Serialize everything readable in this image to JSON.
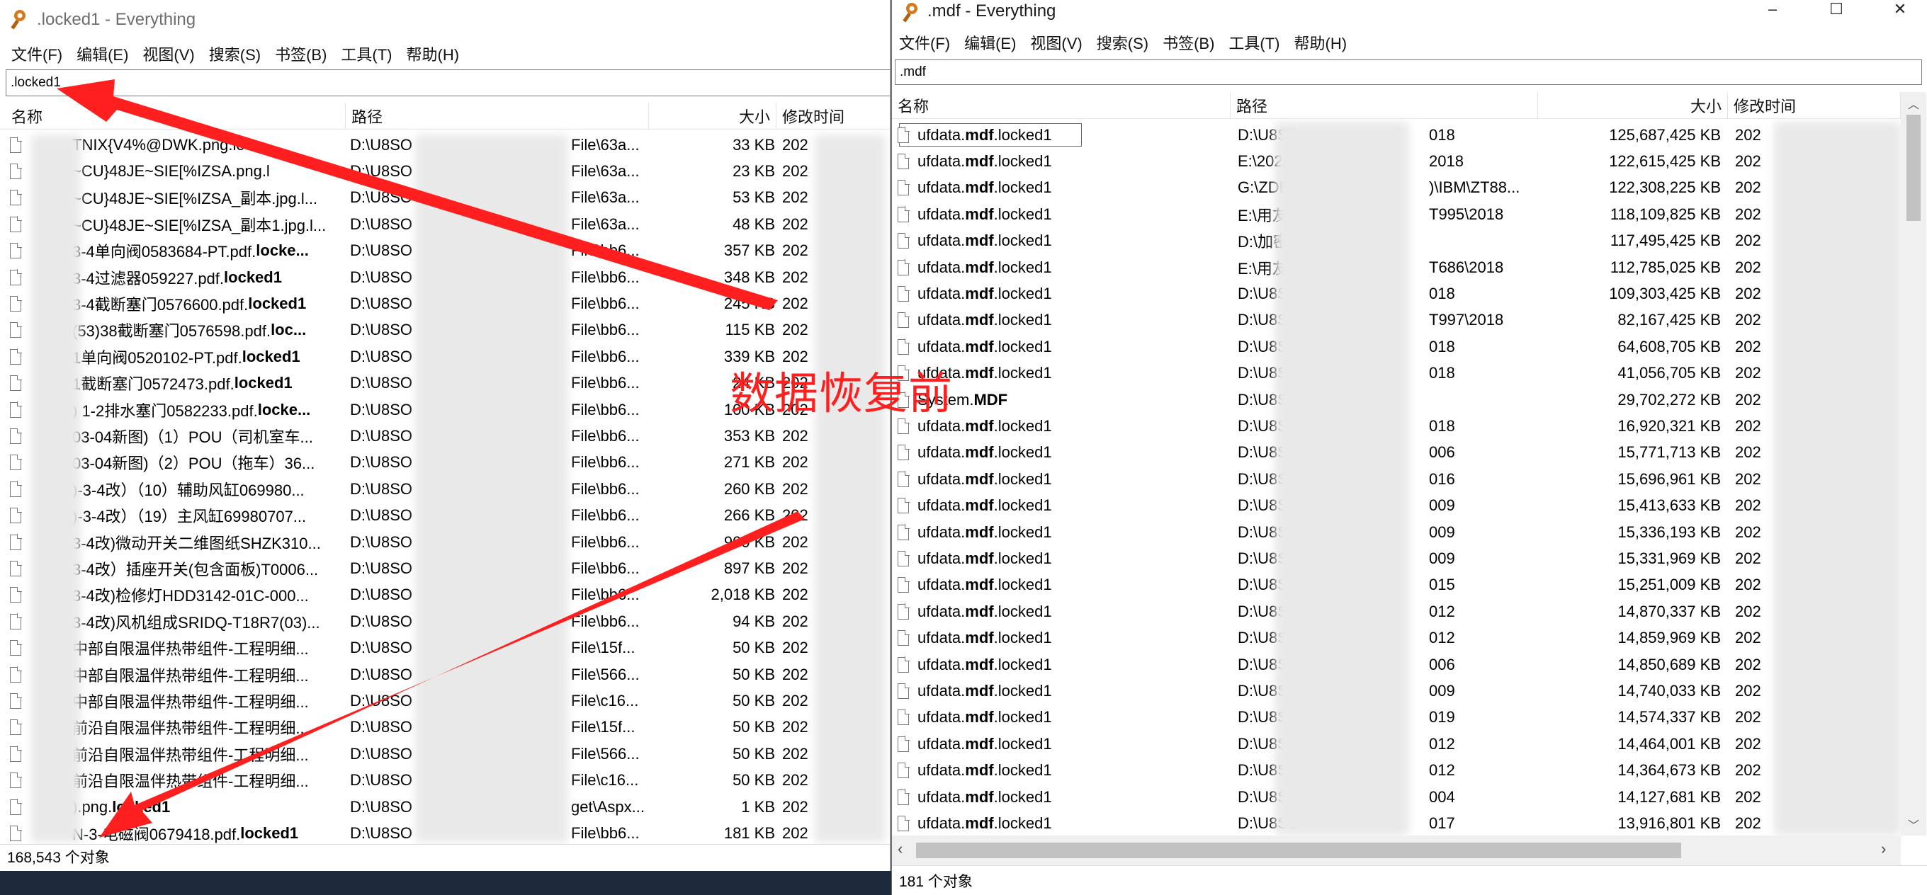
{
  "left": {
    "title": ".locked1 - Everything",
    "menu": [
      "文件(F)",
      "编辑(E)",
      "视图(V)",
      "搜索(S)",
      "书签(B)",
      "工具(T)",
      "帮助(H)"
    ],
    "search": ".locked1",
    "columns": {
      "name": "名称",
      "path": "路径",
      "size": "大小",
      "modified": "修改时间"
    },
    "rows": [
      {
        "name_pre": "TNIX{V4%@DW",
        "name_bold": "",
        "name_post": "K.png.loc...",
        "path": "D:\\U8SO",
        "path_tail": "File\\63a...",
        "size": "33 KB",
        "mod": "202"
      },
      {
        "name_pre": "~CU}48JE~SIE[%IZSA.png.l",
        "name_bold": "",
        "name_post": "",
        "path": "D:\\U8SO",
        "path_tail": "File\\63a...",
        "size": "23 KB",
        "mod": "202"
      },
      {
        "name_pre": "~CU}48JE~SIE[%IZSA_副本.jpg.l...",
        "name_bold": "",
        "name_post": "",
        "path": "D:\\U8SO",
        "path_tail": "File\\63a...",
        "size": "53 KB",
        "mod": "202"
      },
      {
        "name_pre": "~CU}48JE~SIE[%IZSA_副本1.jpg.l...",
        "name_bold": "",
        "name_post": "",
        "path": "D:\\U8SO",
        "path_tail": "File\\63a...",
        "size": "48 KB",
        "mod": "202"
      },
      {
        "name_pre": "3-4单向阀0583684-PT.pdf.",
        "name_bold": "locke...",
        "name_post": "",
        "path": "D:\\U8SO",
        "path_tail": "File\\bb6...",
        "size": "357 KB",
        "mod": "202"
      },
      {
        "name_pre": "3-4过滤器059227.pdf.",
        "name_bold": "locked1",
        "name_post": "",
        "path": "D:\\U8SO",
        "path_tail": "File\\bb6...",
        "size": "348 KB",
        "mod": "202"
      },
      {
        "name_pre": "3-4截断塞门0576600.pdf.",
        "name_bold": "locked1",
        "name_post": "",
        "path": "D:\\U8SO",
        "path_tail": "File\\bb6...",
        "size": "245 KB",
        "mod": "202"
      },
      {
        "name_pre": "(53)38截断塞门0576598.pdf.",
        "name_bold": "loc...",
        "name_post": "",
        "path": "D:\\U8SO",
        "path_tail": "File\\bb6...",
        "size": "115 KB",
        "mod": "202"
      },
      {
        "name_pre": "1单向阀0520102-PT.pdf.",
        "name_bold": "locked1",
        "name_post": "",
        "path": "D:\\U8SO",
        "path_tail": "File\\bb6...",
        "size": "339 KB",
        "mod": "202"
      },
      {
        "name_pre": "1截断塞门0572473.pdf.",
        "name_bold": "locked1",
        "name_post": "",
        "path": "D:\\U8SO",
        "path_tail": "File\\bb6...",
        "size": "24 KB",
        "mod": "202"
      },
      {
        "name_pre": ") 1-2排水塞门0582233.pdf.",
        "name_bold": "locke...",
        "name_post": "",
        "path": "D:\\U8SO",
        "path_tail": "File\\bb6...",
        "size": "100 KB",
        "mod": "202"
      },
      {
        "name_pre": "03-04新图)（1）POU（司机室车...",
        "name_bold": "",
        "name_post": "",
        "path": "D:\\U8SO",
        "path_tail": "File\\bb6...",
        "size": "353 KB",
        "mod": "202"
      },
      {
        "name_pre": "03-04新图)（2）POU（拖车）36...",
        "name_bold": "",
        "name_post": "",
        "path": "D:\\U8SO",
        "path_tail": "File\\bb6...",
        "size": "271 KB",
        "mod": "202"
      },
      {
        "name_pre": ")-3-4改）（10）辅助风缸069980...",
        "name_bold": "",
        "name_post": "",
        "path": "D:\\U8SO",
        "path_tail": "File\\bb6...",
        "size": "260 KB",
        "mod": "202"
      },
      {
        "name_pre": ")-3-4改）（19）主风缸69980707...",
        "name_bold": "",
        "name_post": "",
        "path": "D:\\U8SO",
        "path_tail": "File\\bb6...",
        "size": "266 KB",
        "mod": "202"
      },
      {
        "name_pre": "3-4改)微动开关二维图纸SHZK310...",
        "name_bold": "",
        "name_post": "",
        "path": "D:\\U8SO",
        "path_tail": "File\\bb6...",
        "size": "900 KB",
        "mod": "202"
      },
      {
        "name_pre": "3-4改）插座开关(包含面板)T0006...",
        "name_bold": "",
        "name_post": "",
        "path": "D:\\U8SO",
        "path_tail": "File\\bb6...",
        "size": "897 KB",
        "mod": "202"
      },
      {
        "name_pre": "3-4改)检修灯HDD3142-01C-000...",
        "name_bold": "",
        "name_post": "",
        "path": "D:\\U8SO",
        "path_tail": "File\\bb6...",
        "size": "2,018 KB",
        "mod": "202"
      },
      {
        "name_pre": "3-4改)风机组成SRIDQ-T18R7(03)...",
        "name_bold": "",
        "name_post": "",
        "path": "D:\\U8SO",
        "path_tail": "File\\bb6...",
        "size": "94 KB",
        "mod": "202"
      },
      {
        "name_pre": "中部自限温伴热带组件-工程明细...",
        "name_bold": "",
        "name_post": "",
        "path": "D:\\U8SO",
        "path_tail": "File\\15f...",
        "size": "50 KB",
        "mod": "202"
      },
      {
        "name_pre": "中部自限温伴热带组件-工程明细...",
        "name_bold": "",
        "name_post": "",
        "path": "D:\\U8SO",
        "path_tail": "File\\566...",
        "size": "50 KB",
        "mod": "202"
      },
      {
        "name_pre": "中部自限温伴热带组件-工程明细...",
        "name_bold": "",
        "name_post": "",
        "path": "D:\\U8SO",
        "path_tail": "File\\c16...",
        "size": "50 KB",
        "mod": "202"
      },
      {
        "name_pre": "前沿自限温伴热带组件-工程明细...",
        "name_bold": "",
        "name_post": "",
        "path": "D:\\U8SO",
        "path_tail": "File\\15f...",
        "size": "50 KB",
        "mod": "202"
      },
      {
        "name_pre": "前沿自限温伴热带组件-工程明细...",
        "name_bold": "",
        "name_post": "",
        "path": "D:\\U8SO",
        "path_tail": "File\\566...",
        "size": "50 KB",
        "mod": "202"
      },
      {
        "name_pre": "前沿自限温伴热带组件-工程明细...",
        "name_bold": "",
        "name_post": "",
        "path": "D:\\U8SO",
        "path_tail": "File\\c16...",
        "size": "50 KB",
        "mod": "202"
      },
      {
        "name_pre": ").png.",
        "name_bold": "locked1",
        "name_post": "",
        "path": "D:\\U8SO",
        "path_tail": "get\\Aspx...",
        "size": "1 KB",
        "mod": "202"
      },
      {
        "name_pre": "N-3-电磁阀0679418.pdf.",
        "name_bold": "locked1",
        "name_post": "",
        "path": "D:\\U8SO",
        "path_tail": "File\\bb6...",
        "size": "181 KB",
        "mod": "202"
      }
    ],
    "status": "168,543 个对象"
  },
  "right": {
    "title": ".mdf - Everything",
    "menu": [
      "文件(F)",
      "编辑(E)",
      "视图(V)",
      "搜索(S)",
      "书签(B)",
      "工具(T)",
      "帮助(H)"
    ],
    "search": ".mdf",
    "columns": {
      "name": "名称",
      "path": "路径",
      "size": "大小",
      "modified": "修改时间"
    },
    "rows": [
      {
        "name_pre": "ufdata.",
        "name_bold": "mdf",
        "name_post": ".locked1",
        "path": "D:\\U8SO",
        "path_tail": "018",
        "size": "125,687,425 KB",
        "mod": "202"
      },
      {
        "name_pre": "ufdata.",
        "name_bold": "mdf",
        "name_post": ".locked1",
        "path": "E:\\20220",
        "path_tail": "2018",
        "size": "122,615,425 KB",
        "mod": "202"
      },
      {
        "name_pre": "ufdata.",
        "name_bold": "mdf",
        "name_post": ".locked1",
        "path": "G:\\ZDBF",
        "path_tail": ")\\IBM\\ZT88...",
        "size": "122,308,225 KB",
        "mod": "202"
      },
      {
        "name_pre": "ufdata.",
        "name_bold": "mdf",
        "name_post": ".locked1",
        "path": "E:\\用友软",
        "path_tail": "T995\\2018",
        "size": "118,109,825 KB",
        "mod": "202"
      },
      {
        "name_pre": "ufdata.",
        "name_bold": "mdf",
        "name_post": ".locked1",
        "path": "D:\\加密\\",
        "path_tail": "",
        "size": "117,495,425 KB",
        "mod": "202"
      },
      {
        "name_pre": "ufdata.",
        "name_bold": "mdf",
        "name_post": ".locked1",
        "path": "E:\\用友软",
        "path_tail": "T686\\2018",
        "size": "112,785,025 KB",
        "mod": "202"
      },
      {
        "name_pre": "ufdata.",
        "name_bold": "mdf",
        "name_post": ".locked1",
        "path": "D:\\U8SO",
        "path_tail": "018",
        "size": "109,303,425 KB",
        "mod": "202"
      },
      {
        "name_pre": "ufdata.",
        "name_bold": "mdf",
        "name_post": ".locked1",
        "path": "D:\\U8SO",
        "path_tail": "T997\\2018",
        "size": "82,167,425 KB",
        "mod": "202"
      },
      {
        "name_pre": "ufdata.",
        "name_bold": "mdf",
        "name_post": ".locked1",
        "path": "D:\\U8SO",
        "path_tail": "018",
        "size": "64,608,705 KB",
        "mod": "202"
      },
      {
        "name_pre": "ufdata.",
        "name_bold": "mdf",
        "name_post": ".locked1",
        "path": "D:\\U8SO",
        "path_tail": "018",
        "size": "41,056,705 KB",
        "mod": "202"
      },
      {
        "name_pre": "System.",
        "name_bold": "MDF",
        "name_post": "",
        "path": "D:\\U8SO",
        "path_tail": "",
        "size": "29,702,272 KB",
        "mod": "202"
      },
      {
        "name_pre": "ufdata.",
        "name_bold": "mdf",
        "name_post": ".locked1",
        "path": "D:\\U8SO",
        "path_tail": "018",
        "size": "16,920,321 KB",
        "mod": "202"
      },
      {
        "name_pre": "ufdata.",
        "name_bold": "mdf",
        "name_post": ".locked1",
        "path": "D:\\U8SO",
        "path_tail": "006",
        "size": "15,771,713 KB",
        "mod": "202"
      },
      {
        "name_pre": "ufdata.",
        "name_bold": "mdf",
        "name_post": ".locked1",
        "path": "D:\\U8SO",
        "path_tail": "016",
        "size": "15,696,961 KB",
        "mod": "202"
      },
      {
        "name_pre": "ufdata.",
        "name_bold": "mdf",
        "name_post": ".locked1",
        "path": "D:\\U8SO",
        "path_tail": "009",
        "size": "15,413,633 KB",
        "mod": "202"
      },
      {
        "name_pre": "ufdata.",
        "name_bold": "mdf",
        "name_post": ".locked1",
        "path": "D:\\U8SO",
        "path_tail": "009",
        "size": "15,336,193 KB",
        "mod": "202"
      },
      {
        "name_pre": "ufdata.",
        "name_bold": "mdf",
        "name_post": ".locked1",
        "path": "D:\\U8SO",
        "path_tail": "009",
        "size": "15,331,969 KB",
        "mod": "202"
      },
      {
        "name_pre": "ufdata.",
        "name_bold": "mdf",
        "name_post": ".locked1",
        "path": "D:\\U8SO",
        "path_tail": "015",
        "size": "15,251,009 KB",
        "mod": "202"
      },
      {
        "name_pre": "ufdata.",
        "name_bold": "mdf",
        "name_post": ".locked1",
        "path": "D:\\U8SO",
        "path_tail": "012",
        "size": "14,870,337 KB",
        "mod": "202"
      },
      {
        "name_pre": "ufdata.",
        "name_bold": "mdf",
        "name_post": ".locked1",
        "path": "D:\\U8SO",
        "path_tail": "012",
        "size": "14,859,969 KB",
        "mod": "202"
      },
      {
        "name_pre": "ufdata.",
        "name_bold": "mdf",
        "name_post": ".locked1",
        "path": "D:\\U8SO",
        "path_tail": "006",
        "size": "14,850,689 KB",
        "mod": "202"
      },
      {
        "name_pre": "ufdata.",
        "name_bold": "mdf",
        "name_post": ".locked1",
        "path": "D:\\U8SO",
        "path_tail": "009",
        "size": "14,740,033 KB",
        "mod": "202"
      },
      {
        "name_pre": "ufdata.",
        "name_bold": "mdf",
        "name_post": ".locked1",
        "path": "D:\\U8SO",
        "path_tail": "019",
        "size": "14,574,337 KB",
        "mod": "202"
      },
      {
        "name_pre": "ufdata.",
        "name_bold": "mdf",
        "name_post": ".locked1",
        "path": "D:\\U8SO",
        "path_tail": "012",
        "size": "14,464,001 KB",
        "mod": "202"
      },
      {
        "name_pre": "ufdata.",
        "name_bold": "mdf",
        "name_post": ".locked1",
        "path": "D:\\U8SO",
        "path_tail": "012",
        "size": "14,364,673 KB",
        "mod": "202"
      },
      {
        "name_pre": "ufdata.",
        "name_bold": "mdf",
        "name_post": ".locked1",
        "path": "D:\\U8SO",
        "path_tail": "004",
        "size": "14,127,681 KB",
        "mod": "202"
      },
      {
        "name_pre": "ufdata.",
        "name_bold": "mdf",
        "name_post": ".locked1",
        "path": "D:\\U8SO",
        "path_tail": "017",
        "size": "13,916,801 KB",
        "mod": "202"
      }
    ],
    "status": "181 个对象"
  },
  "annotation": "数据恢复前",
  "colors": {
    "annotation": "#ff1f1f",
    "arrow": "#ff1f1f",
    "selection": "#5a8ed6"
  },
  "icons": {
    "app": "everything-key-icon",
    "file": "file-icon"
  }
}
